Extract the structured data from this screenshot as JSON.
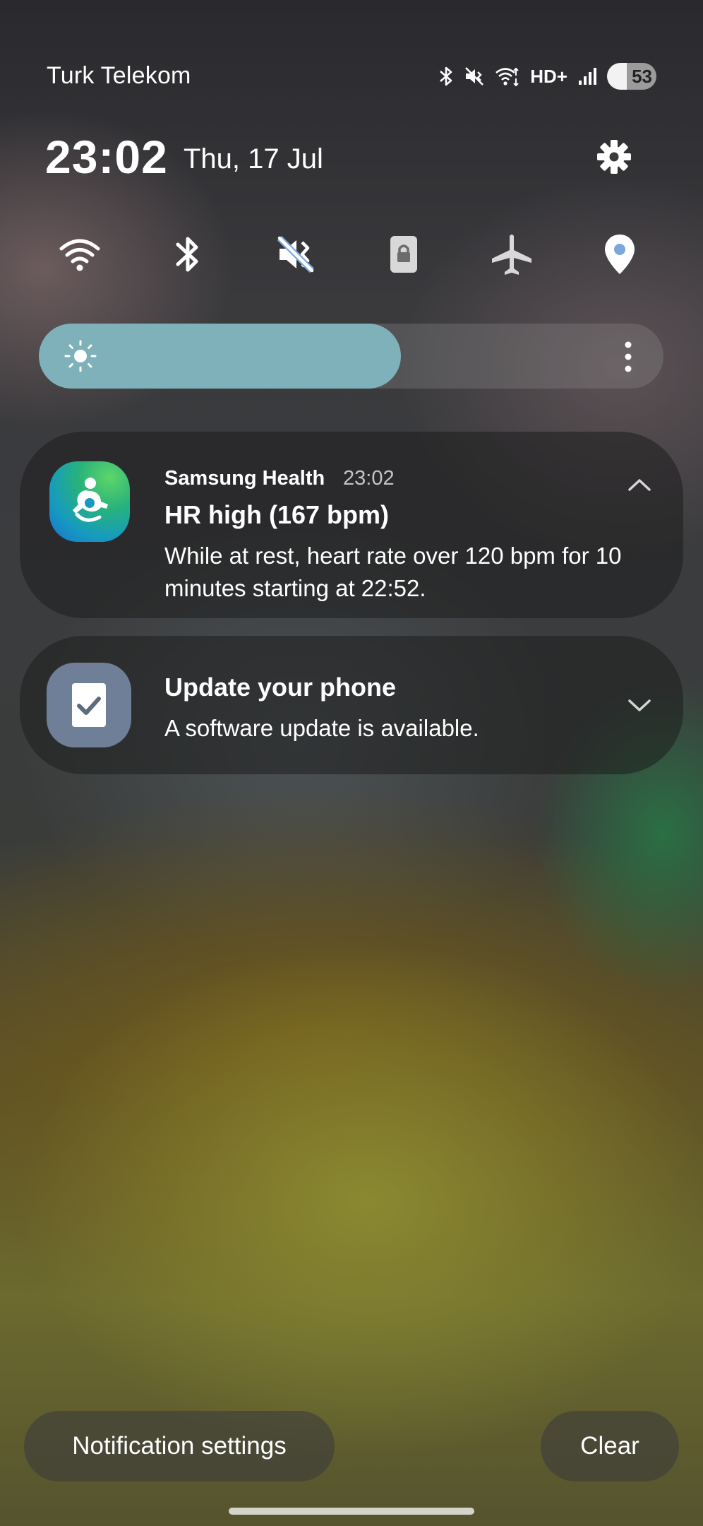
{
  "status_bar": {
    "carrier": "Turk Telekom",
    "network_label": "HD+",
    "battery_level": "53",
    "icons": [
      "bluetooth-icon",
      "mute-icon",
      "wifi-data-icon",
      "hd-plus-icon",
      "signal-icon",
      "battery-saver-icon"
    ]
  },
  "header": {
    "time": "23:02",
    "date": "Thu, 17 Jul"
  },
  "quick_toggles": [
    {
      "name": "wifi",
      "icon": "wifi-icon",
      "state": "on"
    },
    {
      "name": "bluetooth",
      "icon": "bluetooth-icon",
      "state": "on"
    },
    {
      "name": "sound",
      "icon": "mute-icon",
      "state": "on"
    },
    {
      "name": "rotation-lock",
      "icon": "lock-icon",
      "state": "off"
    },
    {
      "name": "airplane-mode",
      "icon": "airplane-icon",
      "state": "off"
    },
    {
      "name": "location",
      "icon": "location-pin-icon",
      "state": "on"
    }
  ],
  "brightness": {
    "level": 0.58
  },
  "notifications": [
    {
      "app": "Samsung Health",
      "time": "23:02",
      "title": "HR high (167 bpm)",
      "body": "While at rest, heart rate over 120 bpm for 10 minutes starting at 22:52.",
      "expanded": true
    },
    {
      "app": "",
      "title": "Update your phone",
      "body": "A software update is available.",
      "expanded": false
    }
  ],
  "footer": {
    "notification_settings_label": "Notification settings",
    "clear_label": "Clear"
  },
  "colors": {
    "toggle_on": "#7ba8dc",
    "brightness_fill": "#7fb1bb",
    "update_icon_bg": "#6f7f98"
  }
}
